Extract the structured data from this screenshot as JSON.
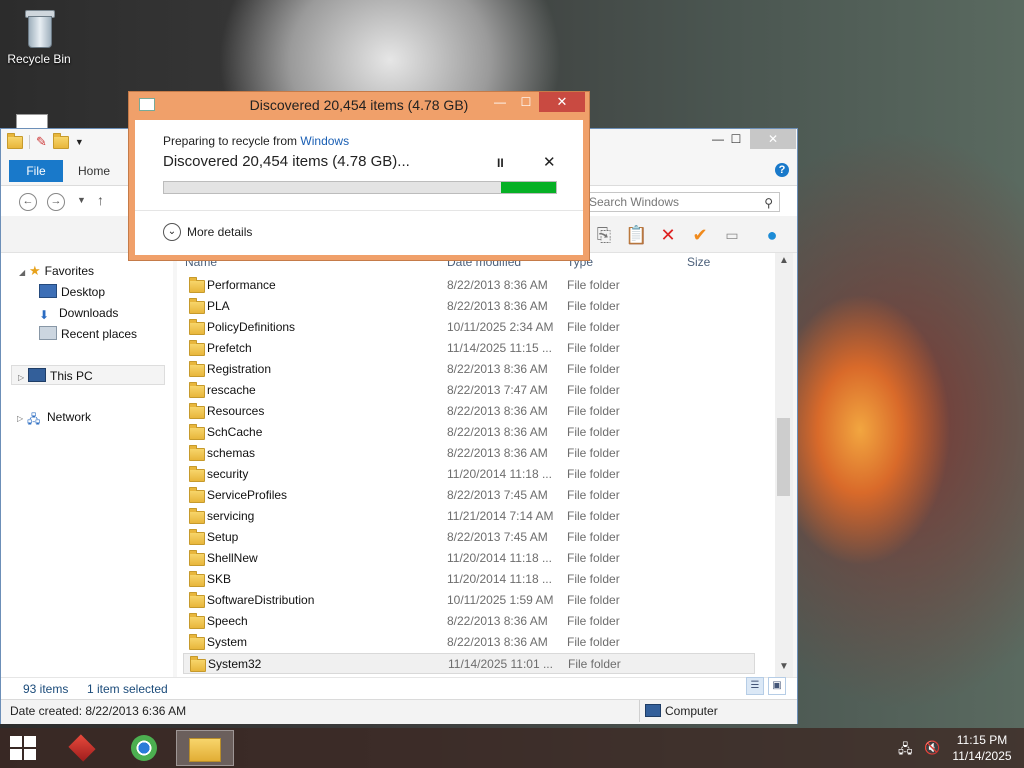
{
  "desktop": {
    "recycle_bin_label": "Recycle Bin"
  },
  "dialog": {
    "title": "Discovered 20,454 items (4.78 GB)",
    "preparing_prefix": "Preparing to recycle from",
    "source_link": "Windows",
    "status_text": "Discovered 20,454 items (4.78 GB)...",
    "pause_glyph": "II",
    "cancel_glyph": "✕",
    "close_glyph": "✕",
    "minimize_glyph": "—",
    "maximize_glyph": "☐",
    "more_details": "More details",
    "progress_fraction": 0.14,
    "progress_color": "#06b025"
  },
  "explorer": {
    "tabs": {
      "file": "File",
      "home": "Home"
    },
    "help_glyph": "?",
    "search_placeholder": "Search Windows",
    "columns": {
      "name": "Name",
      "date": "Date modified",
      "type": "Type",
      "size": "Size"
    },
    "nav": {
      "favorites": "Favorites",
      "desktop": "Desktop",
      "downloads": "Downloads",
      "recent": "Recent places",
      "this_pc": "This PC",
      "network": "Network"
    },
    "rows": [
      {
        "name": "Performance",
        "date": "8/22/2013 8:36 AM",
        "type": "File folder"
      },
      {
        "name": "PLA",
        "date": "8/22/2013 8:36 AM",
        "type": "File folder"
      },
      {
        "name": "PolicyDefinitions",
        "date": "10/11/2025 2:34 AM",
        "type": "File folder"
      },
      {
        "name": "Prefetch",
        "date": "11/14/2025 11:15 ...",
        "type": "File folder"
      },
      {
        "name": "Registration",
        "date": "8/22/2013 8:36 AM",
        "type": "File folder"
      },
      {
        "name": "rescache",
        "date": "8/22/2013 7:47 AM",
        "type": "File folder"
      },
      {
        "name": "Resources",
        "date": "8/22/2013 8:36 AM",
        "type": "File folder"
      },
      {
        "name": "SchCache",
        "date": "8/22/2013 8:36 AM",
        "type": "File folder"
      },
      {
        "name": "schemas",
        "date": "8/22/2013 8:36 AM",
        "type": "File folder"
      },
      {
        "name": "security",
        "date": "11/20/2014 11:18 ...",
        "type": "File folder"
      },
      {
        "name": "ServiceProfiles",
        "date": "8/22/2013 7:45 AM",
        "type": "File folder"
      },
      {
        "name": "servicing",
        "date": "11/21/2014 7:14 AM",
        "type": "File folder"
      },
      {
        "name": "Setup",
        "date": "8/22/2013 7:45 AM",
        "type": "File folder"
      },
      {
        "name": "ShellNew",
        "date": "11/20/2014 11:18 ...",
        "type": "File folder"
      },
      {
        "name": "SKB",
        "date": "11/20/2014 11:18 ...",
        "type": "File folder"
      },
      {
        "name": "SoftwareDistribution",
        "date": "10/11/2025 1:59 AM",
        "type": "File folder"
      },
      {
        "name": "Speech",
        "date": "8/22/2013 8:36 AM",
        "type": "File folder"
      },
      {
        "name": "System",
        "date": "8/22/2013 8:36 AM",
        "type": "File folder"
      },
      {
        "name": "System32",
        "date": "11/14/2025 11:01 ...",
        "type": "File folder",
        "selected": true
      }
    ],
    "status": {
      "count": "93 items",
      "selected": "1 item selected"
    },
    "details": {
      "date_created": "Date created: 8/22/2013 6:36 AM",
      "location": "Computer"
    }
  },
  "taskbar": {
    "time": "11:15 PM",
    "date": "11/14/2025"
  }
}
